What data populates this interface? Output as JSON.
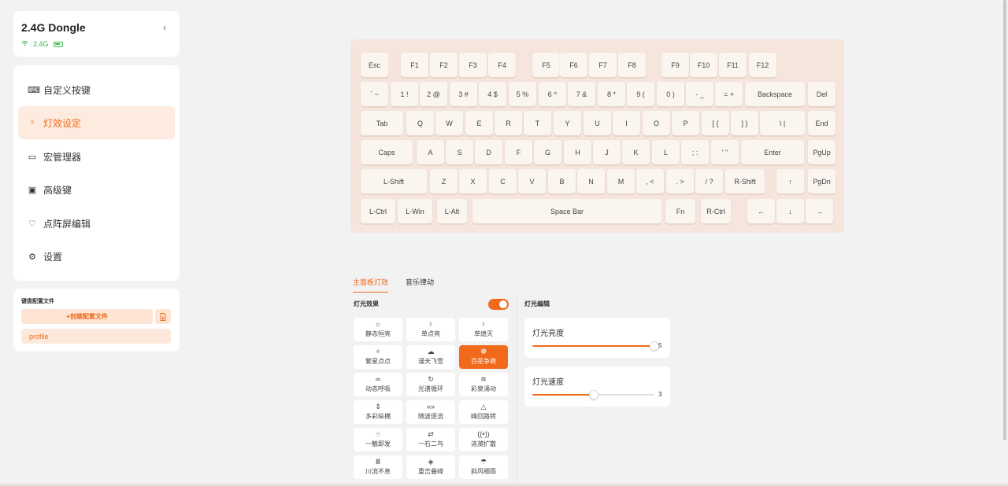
{
  "device": {
    "name": "2.4G Dongle",
    "connection": "2.4G",
    "collapse_icon": "‹"
  },
  "menu": [
    {
      "label": "自定义按键",
      "icon": "keyboard-icon",
      "glyph": "⌨",
      "active": false
    },
    {
      "label": "灯效设定",
      "icon": "bulb-icon",
      "glyph": "♀",
      "active": true
    },
    {
      "label": "宏管理器",
      "icon": "macro-icon",
      "glyph": "▭",
      "active": false
    },
    {
      "label": "高级键",
      "icon": "advanced-key-icon",
      "glyph": "▣",
      "active": false
    },
    {
      "label": "点阵屏编辑",
      "icon": "matrix-icon",
      "glyph": "♡",
      "active": false
    },
    {
      "label": "设置",
      "icon": "gear-icon",
      "glyph": "⚙",
      "active": false
    }
  ],
  "profiles": {
    "title": "键盘配置文件",
    "create_label": "+创建配置文件",
    "import_icon": "import-icon",
    "items": [
      "profile"
    ]
  },
  "keyboard": {
    "rows": [
      [
        "Esc",
        "F1",
        "F2",
        "F3",
        "F4",
        "F5",
        "F6",
        "F7",
        "F8",
        "F9",
        "F10",
        "F11",
        "F12"
      ],
      [
        "` ~",
        "1 !",
        "2 @",
        "3 #",
        "4 $",
        "5 %",
        "6 ^",
        "7 &",
        "8 *",
        "9 (",
        "0 )",
        "- _",
        "= +",
        "Backspace",
        "Del"
      ],
      [
        "Tab",
        "Q",
        "W",
        "E",
        "R",
        "T",
        "Y",
        "U",
        "I",
        "O",
        "P",
        "[ {",
        "] }",
        "\\ |",
        "End"
      ],
      [
        "Caps",
        "A",
        "S",
        "D",
        "F",
        "G",
        "H",
        "J",
        "K",
        "L",
        "; :",
        "' \"",
        "Enter",
        "PgUp"
      ],
      [
        "L-Shift",
        "Z",
        "X",
        "C",
        "V",
        "B",
        "N",
        "M",
        ", <",
        ". >",
        "/ ?",
        "R-Shift",
        "↑",
        "PgDn"
      ],
      [
        "L-Ctrl",
        "L-Win",
        "L-Alt",
        "Space Bar",
        "Fn",
        "R-Ctrl",
        "←",
        "↓",
        "→"
      ]
    ]
  },
  "tabs": [
    {
      "label": "主面板灯效",
      "active": true
    },
    {
      "label": "音乐律动",
      "active": false
    }
  ],
  "effects": {
    "title": "灯光效果",
    "enabled": true,
    "items": [
      {
        "label": "静态恒亮",
        "icon": "sun-icon",
        "glyph": "☼",
        "active": false
      },
      {
        "label": "单点亮",
        "icon": "bulb-icon",
        "glyph": "♀",
        "active": false
      },
      {
        "label": "单熄灭",
        "icon": "bulb-off-icon",
        "glyph": "♀",
        "active": false
      },
      {
        "label": "繁星点点",
        "icon": "stars-icon",
        "glyph": "✧",
        "active": false
      },
      {
        "label": "漫天飞雪",
        "icon": "snow-cloud-icon",
        "glyph": "☁",
        "active": false
      },
      {
        "label": "百花争艳",
        "icon": "flower-icon",
        "glyph": "❁",
        "active": true
      },
      {
        "label": "动态呼吸",
        "icon": "breath-icon",
        "glyph": "∞",
        "active": false
      },
      {
        "label": "光谱循环",
        "icon": "cycle-icon",
        "glyph": "↻",
        "active": false
      },
      {
        "label": "彩泉涌动",
        "icon": "wave-icon",
        "glyph": "≋",
        "active": false
      },
      {
        "label": "多彩纵横",
        "icon": "vertical-arrows-icon",
        "glyph": "⇕",
        "active": false
      },
      {
        "label": "随波逐流",
        "icon": "flow-icon",
        "glyph": "«»",
        "active": false
      },
      {
        "label": "峰回路转",
        "icon": "triangle-icon",
        "glyph": "△",
        "active": false
      },
      {
        "label": "一触即发",
        "icon": "touch-icon",
        "glyph": "☝",
        "active": false
      },
      {
        "label": "一石二鸟",
        "icon": "swap-icon",
        "glyph": "⇄",
        "active": false
      },
      {
        "label": "涟漪扩散",
        "icon": "ripple-icon",
        "glyph": "((•))",
        "active": false
      },
      {
        "label": "川流不息",
        "icon": "stream-icon",
        "glyph": "Ⅲ",
        "active": false
      },
      {
        "label": "重峦叠嶂",
        "icon": "mountain-icon",
        "glyph": "◈",
        "active": false
      },
      {
        "label": "斜风细雨",
        "icon": "rain-icon",
        "glyph": "☂",
        "active": false
      }
    ]
  },
  "edit": {
    "title": "灯光编辑",
    "brightness": {
      "label": "灯光亮度",
      "value": "5",
      "fraction": 1.0
    },
    "speed": {
      "label": "灯光速度",
      "value": "3",
      "fraction": 0.5
    }
  },
  "colors": {
    "accent": "#f06a1a",
    "accent_light": "#fdebe0",
    "keyboard_bg": "#f6e5dc",
    "status_green": "#3bb84a"
  }
}
